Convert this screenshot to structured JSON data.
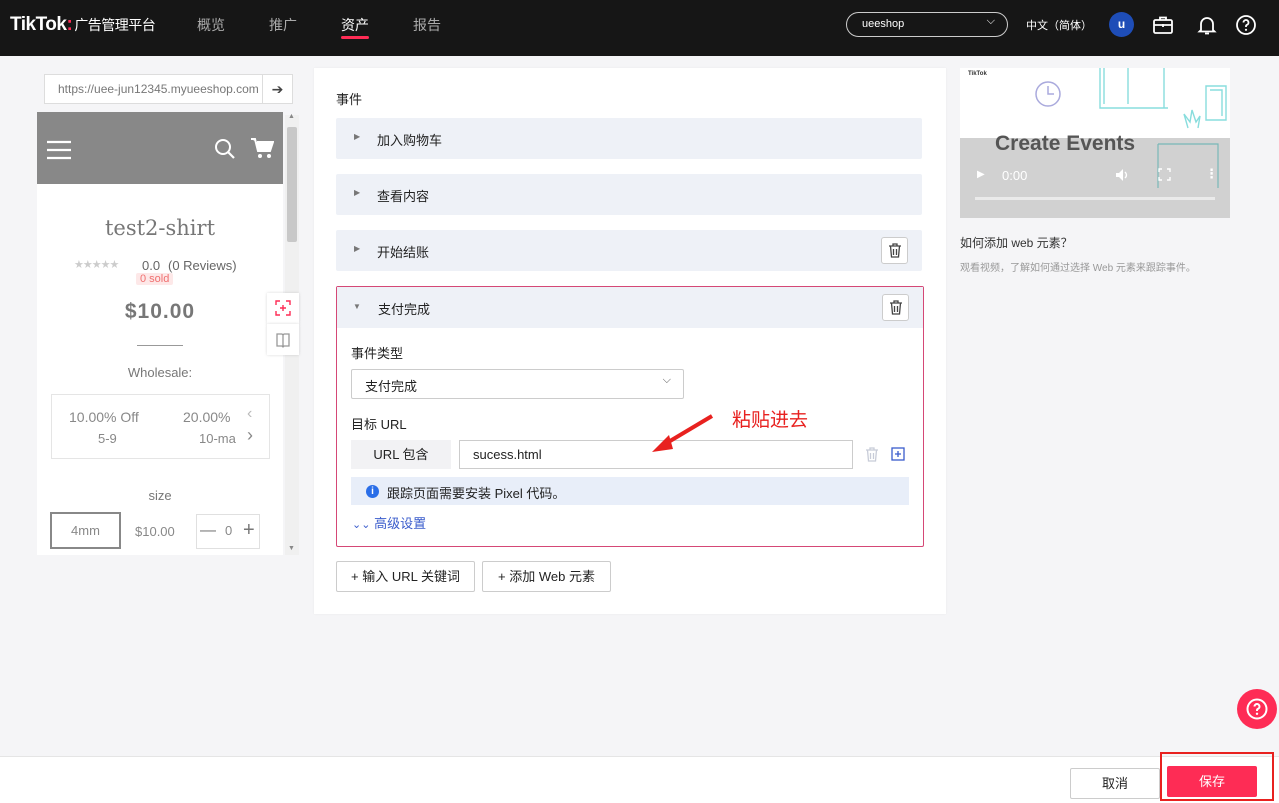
{
  "header": {
    "logo_text": "TikTok",
    "logo_dot": ":",
    "logo_sub": "广告管理平台",
    "nav": [
      "概览",
      "推广",
      "资产",
      "报告"
    ],
    "active_nav_index": 2,
    "account": "ueeshop",
    "language": "中文（简体）",
    "avatar_letter": "u",
    "icons": [
      "briefcase-icon",
      "bell-icon",
      "help-icon"
    ]
  },
  "preview": {
    "url": "https://uee-jun12345.myueeshop.com",
    "product_title": "test2-shirt",
    "rating": "0.0",
    "reviews": "(0 Reviews)",
    "sold_badge": "0 sold",
    "price": "$10.00",
    "wholesale_label": "Wholesale:",
    "wholesale": [
      {
        "discount": "10.00% Off",
        "range": "5-9"
      },
      {
        "discount": "20.00%",
        "range": "10-ma"
      }
    ],
    "size_label": "size",
    "size_option": "4mm",
    "option_price": "$10.00",
    "quantity": "0",
    "minus": "—",
    "plus": "+"
  },
  "events": {
    "section_label": "事件",
    "collapsed": [
      "加入购物车",
      "查看内容",
      "开始结账"
    ],
    "expanded": {
      "name": "支付完成",
      "type_label": "事件类型",
      "type_value": "支付完成",
      "target_url_label": "目标 URL",
      "url_condition": "URL 包含",
      "url_value": "sucess.html",
      "info": "跟踪页面需要安装 Pixel 代码。",
      "advanced": "高级设置"
    },
    "add_keyword_button": "+ 输入 URL 关键词",
    "add_web_element_button": "+ 添加 Web 元素"
  },
  "annotation": "粘贴进去",
  "help": {
    "video_brand": "TikTok",
    "video_title": "Create Events",
    "video_time": "0:00",
    "title": "如何添加 web 元素？",
    "desc": "观看视频，了解如何通过选择 Web 元素来跟踪事件。"
  },
  "footer": {
    "cancel": "取消",
    "save": "保存"
  },
  "colors": {
    "brand": "#fe2c55",
    "link": "#3a5ccc",
    "annotation": "#e8211f",
    "topbar": "#161616"
  }
}
